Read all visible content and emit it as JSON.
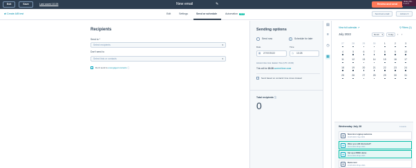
{
  "topbar": {
    "exit_label": "Exit",
    "save_label": "Save",
    "last_saved": "Last saved 10:28",
    "email_title": "New email",
    "review_label": "Review and send",
    "tooltip_line1": "Jenny Wi...",
    "tooltip_line2": "1 on 1"
  },
  "tabbar": {
    "create_ab": "Create A/B test",
    "tabs": [
      "Edit",
      "Settings",
      "Send or schedule",
      "Automation"
    ],
    "new_badge": "NEW",
    "send_test": "Send test email",
    "actions": "Actions"
  },
  "recipients": {
    "title": "Recipients",
    "send_to_label": "Send to *",
    "send_to_placeholder": "Select recipients",
    "dont_send_label": "Don't send to",
    "dont_send_placeholder": "Select lists or contacts",
    "unengaged_prefix": "Don't send to",
    "unengaged_link": "unengaged contacts"
  },
  "sending": {
    "title": "Sending options",
    "send_now": "Send now",
    "schedule_later": "Schedule for later",
    "date_label": "Date",
    "time_label": "Time",
    "date_value": "27/07/2022",
    "time_value": "10:28",
    "tz_note": "Account time zone: Eastern Time (UTC -04:00)",
    "will_be_prefix": "This will be",
    "will_be_time": "15:28",
    "will_be_link": "current time zone",
    "time_zone_option": "Send based on contacts' time zones instead",
    "total_label": "Total recipients",
    "total_value": "0"
  },
  "calendar": {
    "view_full": "View full calendar",
    "month_title": "July 2022",
    "month_btn": "Month",
    "today_btn": "Today",
    "filters": "Filters (1)",
    "weeks": [
      [
        "27",
        "28",
        "29",
        "30",
        "1",
        "2",
        "3"
      ],
      [
        "4",
        "5",
        "6",
        "7",
        "8",
        "9",
        "10"
      ],
      [
        "11",
        "12",
        "13",
        "14",
        "15",
        "16",
        "17"
      ],
      [
        "18",
        "19",
        "20",
        "21",
        "22",
        "23",
        "24"
      ],
      [
        "25",
        "26",
        "27",
        "28",
        "29",
        "30",
        "31"
      ]
    ],
    "muted_first_week": 4,
    "today": "27",
    "agenda_title": "Wednesday July 28",
    "agenda_count": "4 events",
    "events": [
      {
        "title": "New Host signup welcome",
        "sub": "00:28 2022 2 Sep 2019",
        "highlight": false
      },
      {
        "title": "Were you still interested?",
        "sub": "00:21 2021 28 Apr 2021",
        "highlight": true
      },
      {
        "title": "Set up a FREE demo",
        "sub": "00:21 2021 28 Apr 2021",
        "highlight": true
      },
      {
        "title": "Demo test",
        "sub": "10:28 2021 28 Apr 2021",
        "highlight": false
      }
    ]
  },
  "colors": {
    "header": "#2d3e50",
    "accent": "#ff7a59",
    "link": "#0091ae",
    "teal": "#00bda5"
  }
}
